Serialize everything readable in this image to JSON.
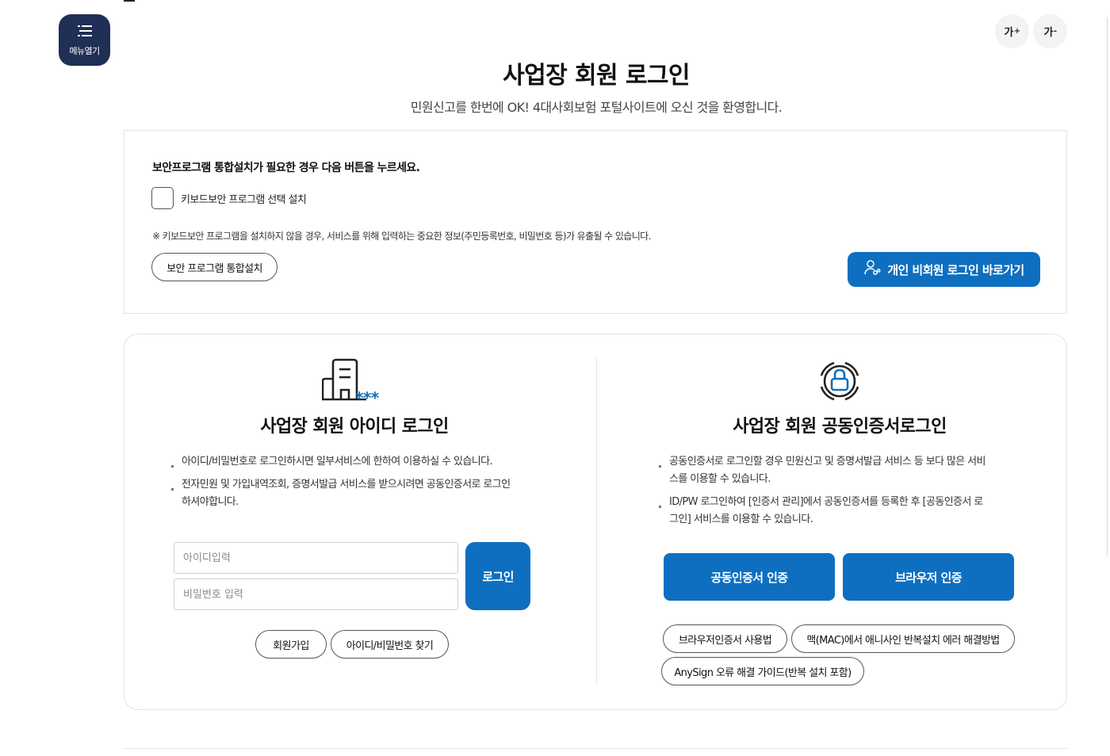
{
  "header": {
    "menu_label": "메뉴열기",
    "font_increase": "가",
    "font_decrease": "가",
    "title": "사업장 회원 로그인",
    "subtitle": "민원신고를 한번에 OK! 4대사회보험 포털사이트에 오신 것을 환영합니다."
  },
  "security": {
    "heading": "보안프로그램 통합설치가 필요한 경우 다음 버튼을 누르세요.",
    "checkbox_label": "키보드보안 프로그램 선택 설치",
    "checkbox_checked": false,
    "note": "※ 키보드보안 프로그램을 설치하지 않을 경우, 서비스를 위해 입력하는 중요한 정보(주민등록번호, 비밀번호 등)가 유출될 수 있습니다.",
    "install_button": "보안 프로그램 통합설치",
    "guest_login_button": "개인 비회원 로그인 바로가기"
  },
  "id_login": {
    "title": "사업장 회원 아이디 로그인",
    "notes": [
      "아이디/비밀번호로 로그인하시면 일부서비스에 한하여 이용하실 수 있습니다.",
      "전자민원 및 가입내역조회, 증명서발급 서비스를 받으시려면 공동인증서로 로그인 하셔야합니다."
    ],
    "id_placeholder": "아이디입력",
    "password_placeholder": "비밀번호 입력",
    "login_button": "로그인",
    "signup_button": "회원가입",
    "find_button": "아이디/비밀번호 찾기"
  },
  "cert_login": {
    "title": "사업장 회원 공동인증서로그인",
    "notes": [
      "공동인증서로 로그인할 경우 민원신고 및 증명서발급 서비스 등 보다 많은 서비스를 이용할 수 있습니다.",
      "ID/PW 로그인하여 [인증서 관리]에서 공동인증서를 등록한 후 [공동인증서 로그인] 서비스를 이용할 수 있습니다."
    ],
    "cert_button": "공동인증서 인증",
    "browser_button": "브라우저 인증",
    "guide_browser": "브라우저인증서 사용법",
    "guide_mac": "맥(MAC)에서 애니사인 반복설치 에러 해결방법",
    "guide_anysign": "AnySign 오류 해결 가이드(반복 설치 포함)"
  },
  "colors": {
    "primary_blue": "#0e6fc0",
    "menu_navy": "#1f2f56",
    "accent_star": "#0e6fc0"
  },
  "icons": {
    "menu": "hamburger-icon",
    "guest": "user-link-icon",
    "id_login": "building-password-icon",
    "cert_login": "lock-circle-icon"
  }
}
